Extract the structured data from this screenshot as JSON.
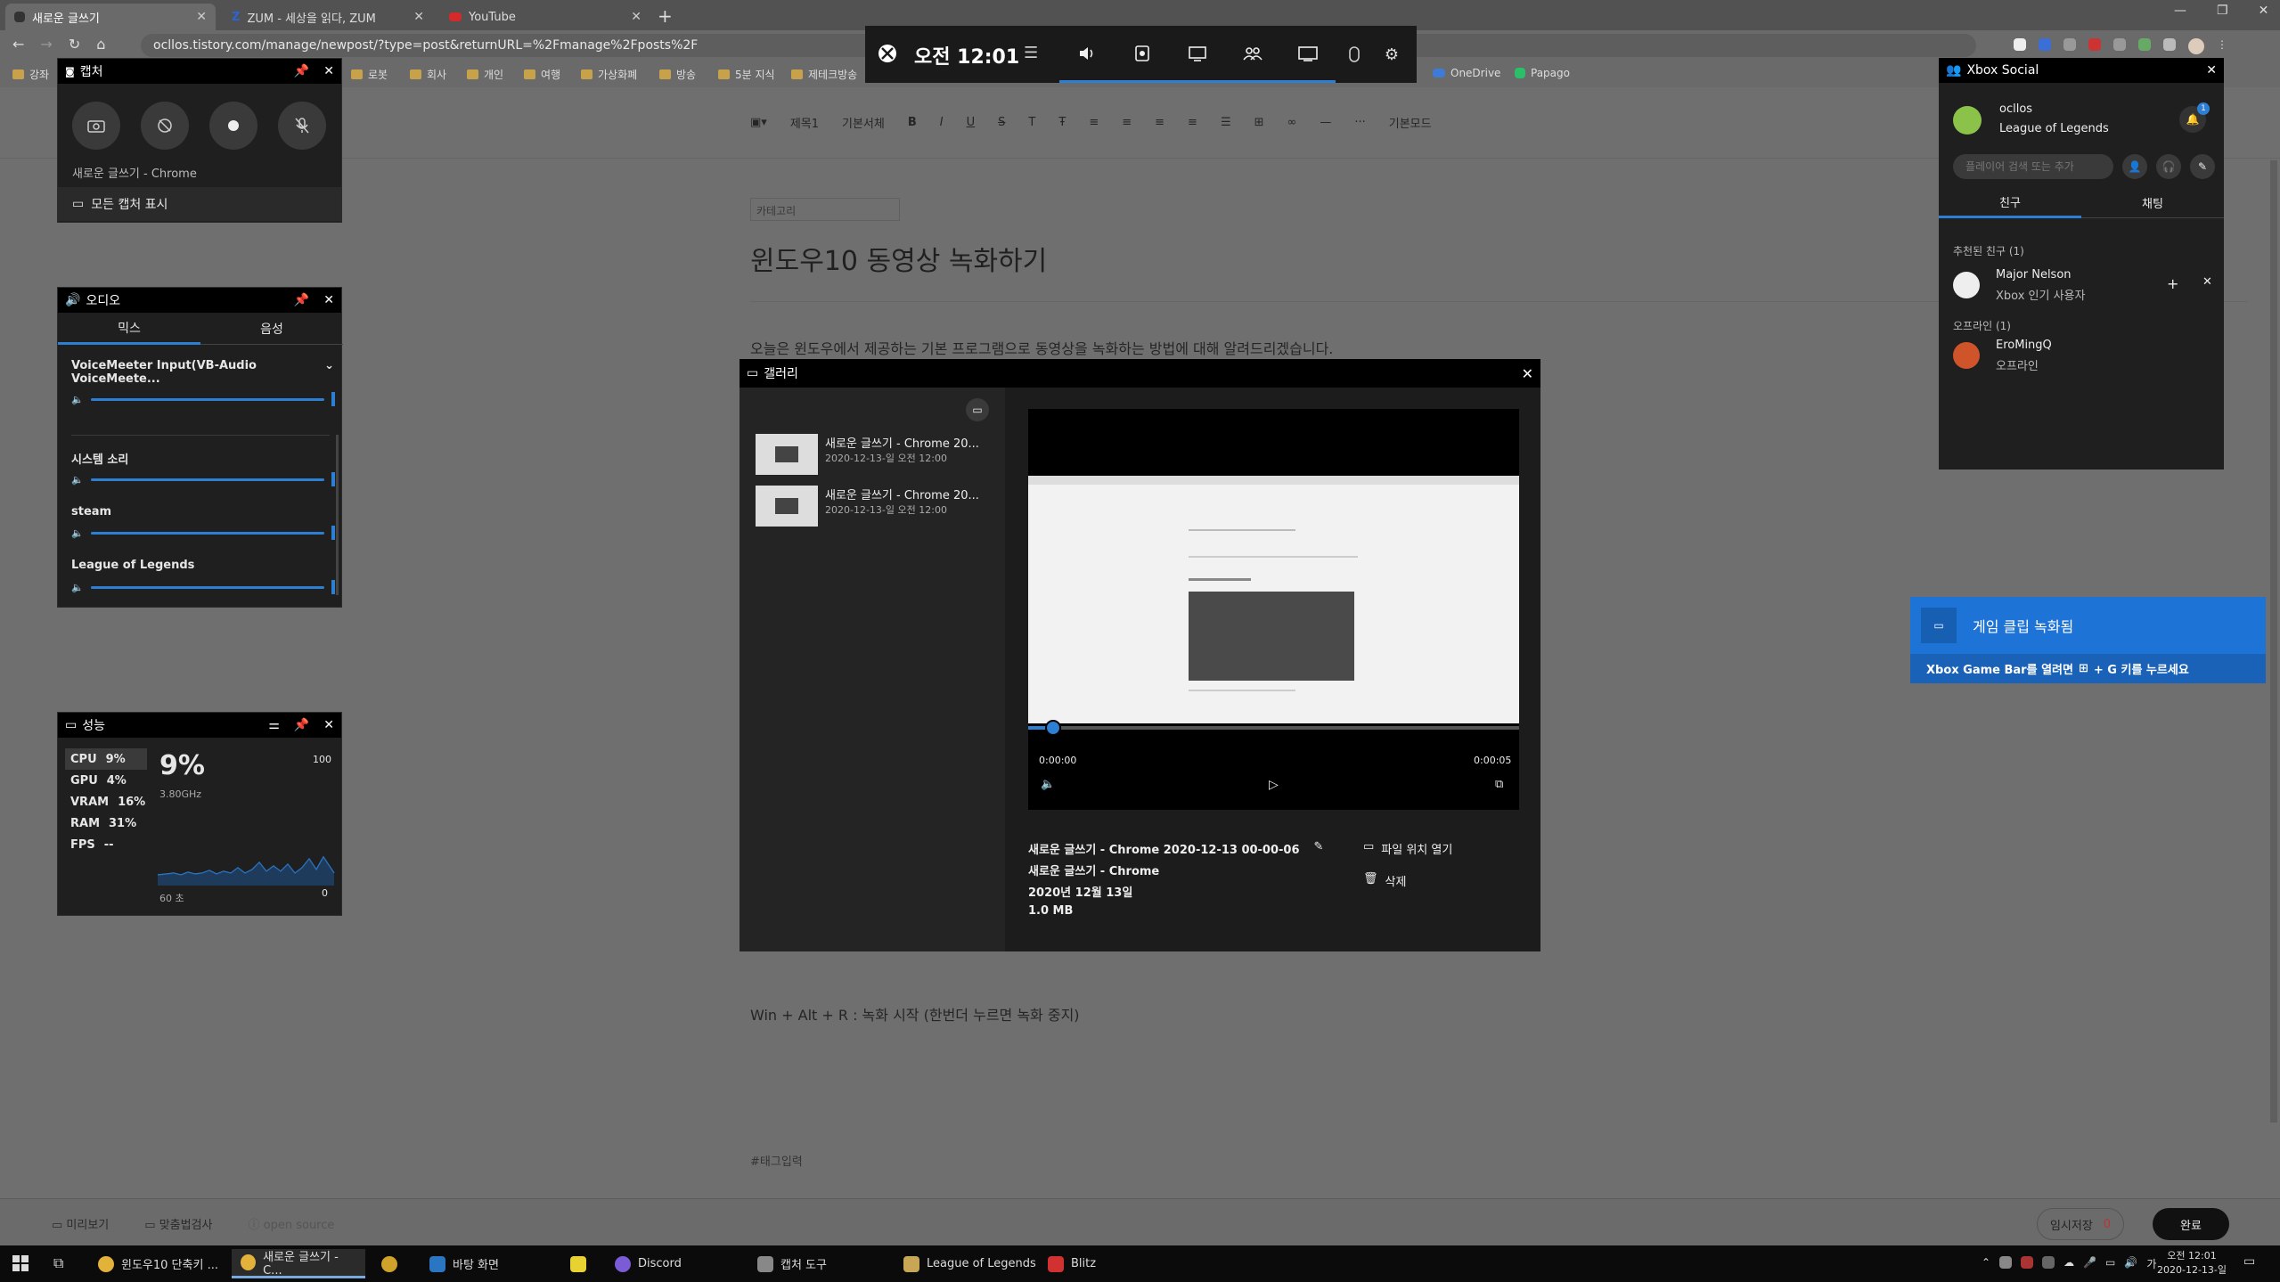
{
  "browser": {
    "tabs": [
      {
        "title": "새로운 글쓰기",
        "active": true
      },
      {
        "title": "ZUM - 세상을 읽다, ZUM",
        "active": false
      },
      {
        "title": "YouTube",
        "active": false
      }
    ],
    "url": "ocllos.tistory.com/manage/newpost/?type=post&returnURL=%2Fmanage%2Fposts%2F",
    "bookmarks": [
      "강좌",
      "로봇",
      "회사",
      "개인",
      "여행",
      "가상화폐",
      "방송",
      "5분 지식",
      "제테크방송"
    ],
    "bookmarks_right": [
      "OneDrive",
      "Papago"
    ]
  },
  "editor": {
    "toolbar": {
      "paragraph": "제목1",
      "font": "기본서체",
      "mode": "기본모드"
    },
    "category": "카테고리",
    "title": "윈도우10 동영상 녹화하기",
    "body_line1": "오늘은 윈도우에서 제공하는 기본 프로그램으로 동영상을 녹화하는 방법에 대해 알려드리겠습니다.",
    "body_line2": "Win + Alt + R : 녹화 시작 (한번더 누르면 녹화 중지)",
    "tag": "#태그입력",
    "bottom": {
      "preview": "미리보기",
      "spell": "맞춤법검사",
      "open_source": "open source",
      "temp_save": "임시저장",
      "temp_count": "0",
      "done": "완료"
    }
  },
  "xbox_bar": {
    "time": "오전 12:01"
  },
  "capture": {
    "title": "캡처",
    "source": "새로운 글쓰기 - Chrome",
    "show_all": "모든 캡처 표시"
  },
  "audio": {
    "title": "오디오",
    "tabs": [
      "믹스",
      "음성"
    ],
    "device": "VoiceMeeter Input(VB-Audio VoiceMeete...",
    "apps": [
      "시스템 소리",
      "steam",
      "League of Legends"
    ]
  },
  "performance": {
    "title": "성능",
    "metrics": [
      {
        "name": "CPU",
        "value": "9%"
      },
      {
        "name": "GPU",
        "value": "4%"
      },
      {
        "name": "VRAM",
        "value": "16%"
      },
      {
        "name": "RAM",
        "value": "31%"
      },
      {
        "name": "FPS",
        "value": "--"
      }
    ],
    "big_value": "9%",
    "freq": "3.80GHz",
    "max": "100",
    "min": "0",
    "duration": "60 초"
  },
  "gallery": {
    "title": "갤러리",
    "items": [
      {
        "name": "새로운 글쓰기 - Chrome 20...",
        "date": "2020-12-13-일 오전 12:00"
      },
      {
        "name": "새로운 글쓰기 - Chrome 20...",
        "date": "2020-12-13-일 오전 12:00"
      }
    ],
    "time_start": "0:00:00",
    "time_end": "0:00:05",
    "progress": 0.05,
    "file_name": "새로운 글쓰기 - Chrome 2020-12-13 00-00-06",
    "app": "새로운 글쓰기 - Chrome",
    "date": "2020년 12월 13일",
    "size": "1.0 MB",
    "open_location": "파일 위치 열기",
    "delete": "삭제"
  },
  "social": {
    "title": "Xbox Social",
    "user": "ocllos",
    "game": "League of Legends",
    "badge": "1",
    "search_placeholder": "플레이어 검색 또는 추가",
    "tabs": [
      "친구",
      "채팅"
    ],
    "suggested_header": "추천된 친구 (1)",
    "suggested": {
      "name": "Major Nelson",
      "status": "Xbox 인기 사용자"
    },
    "offline_header": "오프라인 (1)",
    "offline": {
      "name": "EroMingQ",
      "status": "오프라인"
    }
  },
  "notification": {
    "title": "게임 클립 녹화됨",
    "body_pre": "Xbox Game Bar를 열려면",
    "body_post": "+ G 키를 누르세요"
  },
  "taskbar": {
    "items": [
      "윈도우10 단축키 ...",
      "새로운 글쓰기 - C...",
      "",
      "바탕 화면",
      "",
      "Discord",
      "캡처 도구",
      "League of Legends",
      "Blitz"
    ],
    "ime": "가",
    "time": "오전 12:01",
    "date": "2020-12-13-일"
  },
  "colors": {
    "accent": "#2d7fd3",
    "notif": "#1e73d6"
  }
}
